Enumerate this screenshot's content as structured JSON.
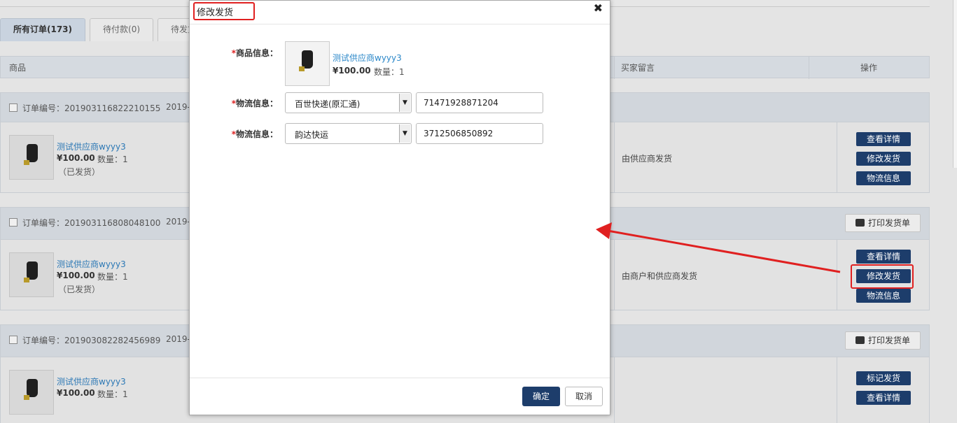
{
  "tabs": [
    {
      "label": "所有订单(173)"
    },
    {
      "label": "待付款(0)"
    },
    {
      "label": "待发货"
    }
  ],
  "table_head": {
    "product": "商品",
    "buyer_note": "买家留言",
    "operation": "操作"
  },
  "orders": [
    {
      "order_no": "订单编号：201903116822210155",
      "date": "2019-",
      "product_name": "测试供应商wyyy3",
      "price": "¥100.00",
      "qty": "数量：1",
      "status": "（已发货）",
      "remark": "由供应商发货",
      "actions": [
        "查看详情",
        "修改发货",
        "物流信息"
      ]
    },
    {
      "order_no": "订单编号：201903116808048100",
      "date": "2019-",
      "print_label": "打印发货单",
      "product_name": "测试供应商wyyy3",
      "price": "¥100.00",
      "qty": "数量：1",
      "status": "（已发货）",
      "remark": "由商户和供应商发货",
      "actions": [
        "查看详情",
        "修改发货",
        "物流信息"
      ]
    },
    {
      "order_no": "订单编号：201903082282456989",
      "date": "2019-",
      "print_label": "打印发货单",
      "product_name": "测试供应商wyyy3",
      "price": "¥100.00",
      "qty": "数量：1",
      "actions": [
        "标记发货",
        "查看详情"
      ]
    }
  ],
  "modal": {
    "title": "修改发货",
    "product_label": "商品信息：",
    "product_name": "测试供应商wyyy3",
    "price": "¥100.00",
    "qty": "数量：1",
    "logistics": [
      {
        "label": "物流信息：",
        "carrier": "百世快递(原汇通)",
        "tracking_no": "71471928871204"
      },
      {
        "label": "物流信息：",
        "carrier": "韵达快运",
        "tracking_no": "3712506850892"
      }
    ],
    "ok_label": "确定",
    "cancel_label": "取消"
  },
  "colors": {
    "primary_button": "#1d3d6b",
    "link": "#2c88c9",
    "annotation": "#e02020"
  }
}
